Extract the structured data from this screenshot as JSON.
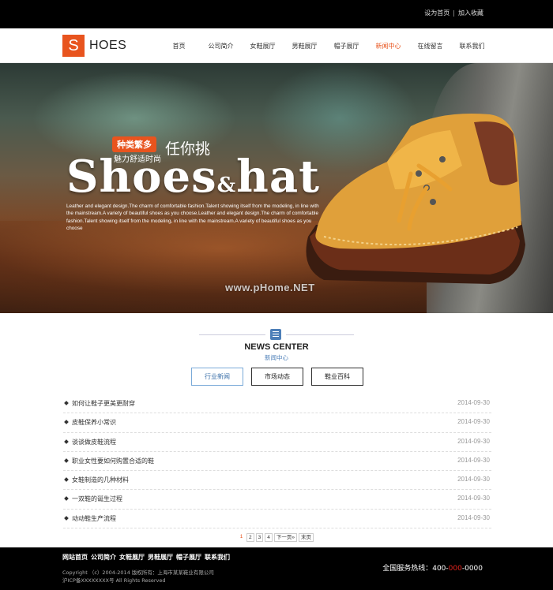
{
  "topbar": {
    "set_home": "设为首页",
    "separator": "|",
    "add_favorite": "加入收藏"
  },
  "logo": {
    "letter": "S",
    "rest": "HOES"
  },
  "nav": {
    "items": [
      "首页",
      "公司简介",
      "女鞋展厅",
      "男鞋展厅",
      "帽子展厅",
      "新闻中心",
      "在线留言",
      "联系我们"
    ],
    "active_index": 5
  },
  "hero": {
    "badge": "种类繁多",
    "slogan_main": "任你挑",
    "slogan_sub": "魅力舒适时尚",
    "title_left": "Shoes",
    "title_amp": "&",
    "title_right": "hat",
    "description": "Leather and elegant design.The charm of comfortable fashion.Talent showing itself from the modeling, in line with the mainstream.A variety of beautiful shoes as you choose.Leather and elegant design.The charm of comfortable fashion.Talent showing itself from the modeling, in line with the mainstream.A variety of beautiful shoes as you choose",
    "watermark": "www.pHome.NET"
  },
  "news": {
    "title": "NEWS CENTER",
    "subtitle": "新闻中心",
    "tabs": [
      "行业新闻",
      "市场动态",
      "鞋业百科"
    ],
    "active_tab": 0,
    "items": [
      {
        "title": "如何让鞋子更美更耐穿",
        "date": "2014-09-30"
      },
      {
        "title": "皮鞋保养小常识",
        "date": "2014-09-30"
      },
      {
        "title": "谈谈做皮鞋流程",
        "date": "2014-09-30"
      },
      {
        "title": "职业女性要如何购置合适的鞋",
        "date": "2014-09-30"
      },
      {
        "title": "女鞋制造的几种材料",
        "date": "2014-09-30"
      },
      {
        "title": "一双鞋的诞生过程",
        "date": "2014-09-30"
      },
      {
        "title": "动动鞋生产流程",
        "date": "2014-09-30"
      }
    ]
  },
  "pager": {
    "pages": [
      "1",
      "2",
      "3",
      "4"
    ],
    "current": "1",
    "next": "下一页»",
    "last": "末页"
  },
  "footer": {
    "links": [
      "网站首页",
      "公司简介",
      "女鞋展厅",
      "男鞋展厅",
      "帽子展厅",
      "联系我们"
    ],
    "copyright": "Copyright （c）2004-2014 版权所有：上海市某某鞋业有限公司",
    "icp": "沪ICP备XXXXXXXX号 All Rights Reserved",
    "hotline_label": "全国服务热线：",
    "hotline_a": "400-",
    "hotline_b": "000",
    "hotline_c": "-0000"
  },
  "colors": {
    "accent": "#e8541e",
    "link_blue": "#4d7fb8",
    "dark": "#000000"
  }
}
